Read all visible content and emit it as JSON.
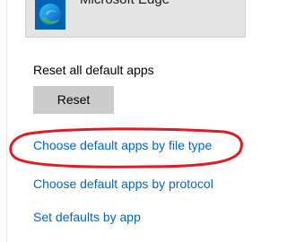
{
  "app_tile": {
    "icon": "microsoft-edge-icon",
    "name": "Microsoft Edge"
  },
  "reset": {
    "label": "Reset all default apps",
    "button_label": "Reset"
  },
  "links": {
    "by_file_type": "Choose default apps by file type",
    "by_protocol": "Choose default apps by protocol",
    "by_app": "Set defaults by app"
  },
  "colors": {
    "link": "#0067c0",
    "highlight": "#e01b24",
    "button_bg": "#cccccc",
    "tile_bg": "#e4e4e4",
    "edge_icon_bg": "#0063b1"
  }
}
